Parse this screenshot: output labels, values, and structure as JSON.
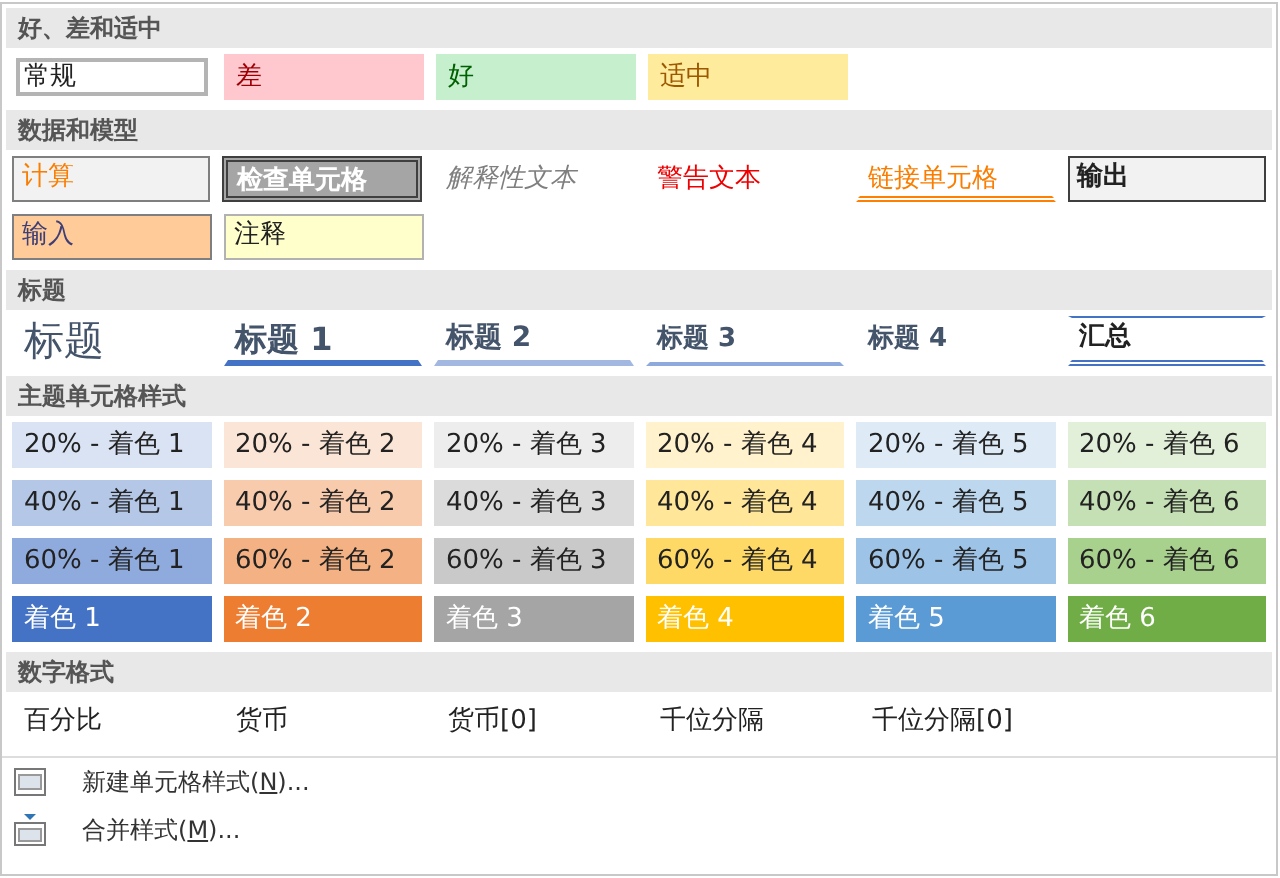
{
  "sections": [
    {
      "title": "好、差和适中",
      "rows": [
        [
          {
            "text": "常规",
            "kind": "normal",
            "selected": true
          },
          {
            "text": "差",
            "kind": "bad",
            "selected": false
          },
          {
            "text": "好",
            "kind": "good",
            "selected": false
          },
          {
            "text": "适中",
            "kind": "neutral",
            "selected": false
          }
        ]
      ]
    },
    {
      "title": "数据和模型",
      "rows": [
        [
          {
            "text": "计算",
            "kind": "calc",
            "selected": false
          },
          {
            "text": "检查单元格",
            "kind": "check",
            "selected": false
          },
          {
            "text": "解释性文本",
            "kind": "explanatory",
            "selected": false
          },
          {
            "text": "警告文本",
            "kind": "warning",
            "selected": false
          },
          {
            "text": "链接单元格",
            "kind": "linked",
            "selected": false
          },
          {
            "text": "输出",
            "kind": "output",
            "selected": false
          }
        ],
        [
          {
            "text": "输入",
            "kind": "input",
            "selected": false
          },
          {
            "text": "注释",
            "kind": "note",
            "selected": false
          }
        ]
      ]
    },
    {
      "title": "标题",
      "rows": [
        [
          {
            "text": "标题",
            "kind": "title",
            "selected": false
          },
          {
            "text": "标题 1",
            "kind": "h1",
            "selected": false
          },
          {
            "text": "标题 2",
            "kind": "h2",
            "selected": false
          },
          {
            "text": "标题 3",
            "kind": "h3",
            "selected": false
          },
          {
            "text": "标题 4",
            "kind": "h4",
            "selected": false
          },
          {
            "text": "汇总",
            "kind": "total",
            "selected": false
          }
        ]
      ]
    },
    {
      "title": "主题单元格样式",
      "rows": [
        [
          {
            "text": "20% - 着色 1",
            "kind": "tint",
            "color": "#dae3f3",
            "selected": false
          },
          {
            "text": "20% - 着色 2",
            "kind": "tint",
            "color": "#fbe5d6",
            "selected": false
          },
          {
            "text": "20% - 着色 3",
            "kind": "tint",
            "color": "#ededed",
            "selected": false
          },
          {
            "text": "20% - 着色 4",
            "kind": "tint",
            "color": "#fff2cc",
            "selected": false
          },
          {
            "text": "20% - 着色 5",
            "kind": "tint",
            "color": "#deebf7",
            "selected": false
          },
          {
            "text": "20% - 着色 6",
            "kind": "tint",
            "color": "#e2f0d9",
            "selected": false
          }
        ],
        [
          {
            "text": "40% - 着色 1",
            "kind": "tint",
            "color": "#b4c7e7",
            "selected": false
          },
          {
            "text": "40% - 着色 2",
            "kind": "tint",
            "color": "#f8cbad",
            "selected": false
          },
          {
            "text": "40% - 着色 3",
            "kind": "tint",
            "color": "#dbdbdb",
            "selected": false
          },
          {
            "text": "40% - 着色 4",
            "kind": "tint",
            "color": "#ffe699",
            "selected": false
          },
          {
            "text": "40% - 着色 5",
            "kind": "tint",
            "color": "#bdd7ee",
            "selected": false
          },
          {
            "text": "40% - 着色 6",
            "kind": "tint",
            "color": "#c5e0b4",
            "selected": false
          }
        ],
        [
          {
            "text": "60% - 着色 1",
            "kind": "tint",
            "color": "#8faadc",
            "selected": false
          },
          {
            "text": "60% - 着色 2",
            "kind": "tint",
            "color": "#f4b183",
            "selected": false
          },
          {
            "text": "60% - 着色 3",
            "kind": "tint",
            "color": "#c9c9c9",
            "selected": false
          },
          {
            "text": "60% - 着色 4",
            "kind": "tint",
            "color": "#ffd966",
            "selected": false
          },
          {
            "text": "60% - 着色 5",
            "kind": "tint",
            "color": "#9dc3e6",
            "selected": false
          },
          {
            "text": "60% - 着色 6",
            "kind": "tint",
            "color": "#a9d18e",
            "selected": false
          }
        ],
        [
          {
            "text": "着色 1",
            "kind": "solid",
            "color": "#4472c4",
            "selected": false
          },
          {
            "text": "着色 2",
            "kind": "solid",
            "color": "#ed7d31",
            "selected": false
          },
          {
            "text": "着色 3",
            "kind": "solid",
            "color": "#a5a5a5",
            "selected": false
          },
          {
            "text": "着色 4",
            "kind": "solid",
            "color": "#ffc000",
            "selected": false
          },
          {
            "text": "着色 5",
            "kind": "solid",
            "color": "#5b9bd5",
            "selected": false
          },
          {
            "text": "着色 6",
            "kind": "solid",
            "color": "#70ad47",
            "selected": false
          }
        ]
      ]
    },
    {
      "title": "数字格式",
      "rows": [
        [
          {
            "text": "百分比",
            "kind": "plain",
            "selected": false
          },
          {
            "text": "货币",
            "kind": "plain",
            "selected": false
          },
          {
            "text": "货币[0]",
            "kind": "plain",
            "selected": false
          },
          {
            "text": "千位分隔",
            "kind": "plain",
            "selected": false
          },
          {
            "text": "千位分隔[0]",
            "kind": "plain",
            "selected": false
          }
        ]
      ]
    }
  ],
  "menu": [
    {
      "kind": "new",
      "before": "新建单元格样式(",
      "key": "N",
      "after": ")..."
    },
    {
      "kind": "merge",
      "before": "合并样式(",
      "key": "M",
      "after": ")..."
    }
  ]
}
